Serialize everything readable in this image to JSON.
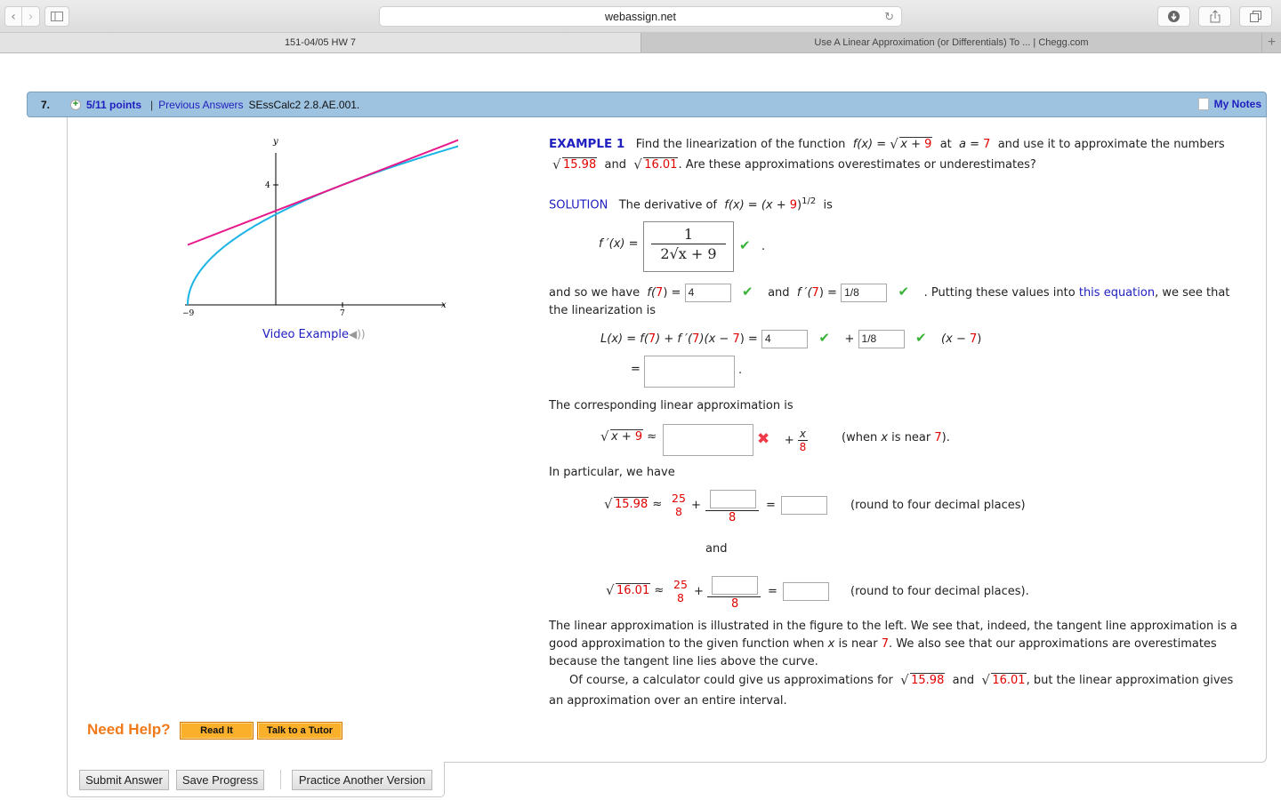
{
  "browser": {
    "url": "webassign.net",
    "tabs": [
      {
        "label": "151-04/05 HW 7",
        "active": true
      },
      {
        "label": "Use A Linear Approximation (or Differentials) To ... | Chegg.com",
        "active": false
      }
    ],
    "icons": {
      "back": "‹",
      "forward": "›",
      "sidebar": "▯",
      "reload": "↻",
      "download": "⬇",
      "share": "⇪",
      "tabs": "❐",
      "new_tab": "+"
    }
  },
  "question": {
    "number": "7.",
    "points": "5/11 points",
    "separator": "|",
    "previous_answers": "Previous Answers",
    "code": "SEssCalc2 2.8.AE.001.",
    "my_notes": "My Notes"
  },
  "graph": {
    "y_label": "y",
    "x_label": "x",
    "y_tick": "4",
    "x_ticks": [
      "−9",
      "7"
    ],
    "curve_color": "#1ab4e6",
    "tangent_color": "#e6188c",
    "video_example": "Video Example"
  },
  "example": {
    "title": "EXAMPLE 1",
    "intro1": "Find the linearization of the function",
    "fx": "f(x) =",
    "radicand_x": "x +",
    "radicand_9": "9",
    "at": "at",
    "a_eq": "a =",
    "a_val": "7",
    "intro2": "and use it to approximate the numbers",
    "n1": "15.98",
    "and": "and",
    "n2": "16.01",
    "question": ". Are these approximations overestimates or underestimates?"
  },
  "solution": {
    "label": "SOLUTION",
    "deriv_text": "The derivative of",
    "fx_eq": "f(x) = (x +",
    "nine": "9",
    "exp": "1/2",
    "is": "is",
    "fprime_label": "f ′(x) =",
    "fprime_num": "1",
    "fprime_den": "2√x + 9",
    "period": ".",
    "have_text": "and so we have",
    "f7_label_a": "f(",
    "seven": "7",
    "f7_label_b": ") =",
    "f7_value": "4",
    "and_text": "and",
    "fp7_label_a": "f ′(",
    "fp7_label_b": ") =",
    "fp7_value": "1/8",
    "putting_text": ". Putting these values into",
    "this_equation": "this equation",
    "we_see": ", we see that",
    "linearization_is": "the linearization is",
    "Lx_label": "L(x)  =  f(",
    "Lx_mid1": ") + f ′(",
    "Lx_mid2": ")(x −",
    "Lx_end": ") =",
    "Lx_val1": "4",
    "plus": "+",
    "Lx_val2": "1/8",
    "x_minus": "(x −",
    "close_paren": ")",
    "eq": "=",
    "Lx_result": "",
    "corresponding": "The corresponding linear approximation is",
    "approx": "≈",
    "approx_input": "",
    "x_over": "x",
    "eight": "8",
    "when_text_a": "(when",
    "when_x": "x",
    "when_text_b": "is near",
    "when_end": ").",
    "in_particular": "In particular, we have",
    "p1_n": "15.98",
    "twentyfive": "25",
    "p1_num_input": "",
    "p1_result": "",
    "round1": "(round to four decimal places)",
    "and_mid": "and",
    "p2_n": "16.01",
    "p2_num_input": "",
    "p2_result": "",
    "round2": "(round to four decimal places).",
    "para1_a": "The linear approximation is illustrated in the figure to the left. We see that, indeed, the tangent line approximation is a",
    "para1_b": "good approximation to the given function when",
    "para1_c": "is near",
    "para1_d": ". We also see that our approximations are overestimates",
    "para1_e": "because the tangent line lies above the curve.",
    "para2_a": "Of course, a calculator could give us approximations for",
    "para2_b": "and",
    "para2_c": ",  but the linear approximation gives",
    "para2_d": "an approximation over an entire interval."
  },
  "help": {
    "need_help": "Need Help?",
    "read_it": "Read It",
    "talk_tutor": "Talk to a Tutor"
  },
  "buttons": {
    "submit": "Submit Answer",
    "save": "Save Progress",
    "practice": "Practice Another Version"
  },
  "status": {
    "fprime": "correct",
    "f7": "correct",
    "fp7": "correct",
    "Lx1": "correct",
    "Lx2": "correct",
    "approx": "incorrect"
  }
}
